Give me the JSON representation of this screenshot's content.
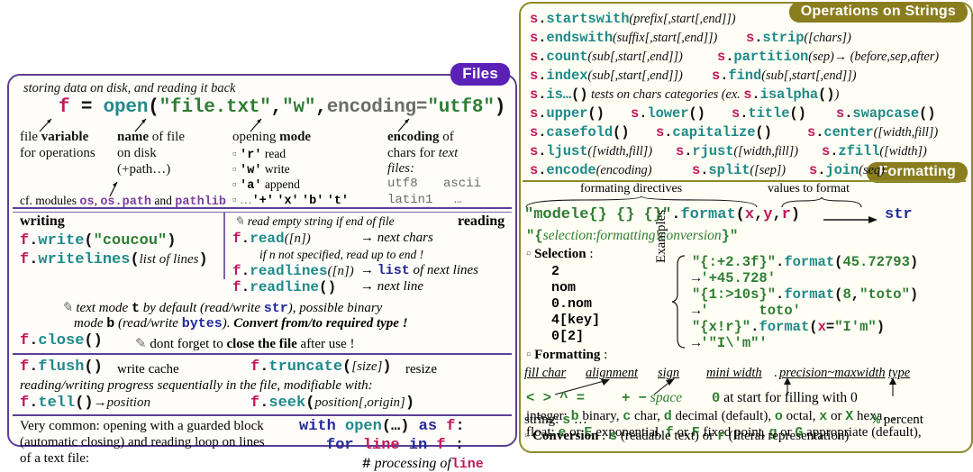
{
  "files_panel": {
    "badge": "Files",
    "intro": "storing data on disk, and reading it back",
    "open_line": {
      "f": "f",
      "eq": "=",
      "open": "open",
      "paren_open": "(",
      "filename": "\"file.txt\"",
      "comma1": ",",
      "mode": "\"w\"",
      "comma2": ",",
      "encoding_kw": "encoding=",
      "encoding_val": "\"utf8\"",
      "paren_close": ")"
    },
    "columns": [
      {
        "title_plain": "file ",
        "title_bold": "variable",
        "lines": [
          "for operations"
        ]
      },
      {
        "title_bold": "name",
        "title_plain": " of file",
        "lines": [
          "on disk",
          "(+path…)"
        ]
      },
      {
        "title_plain": "opening ",
        "title_bold": "mode",
        "modes": [
          {
            "code": "'r'",
            "desc": "read"
          },
          {
            "code": "'w'",
            "desc": "write"
          },
          {
            "code": "'a'",
            "desc": "append"
          }
        ],
        "extra_prefix": "…",
        "extra_codes": [
          "'+'",
          "'x'",
          "'b'",
          "'t'"
        ]
      },
      {
        "title_bold": "encoding",
        "title_plain": " of",
        "lines": [
          "chars for ",
          "files:"
        ],
        "lines_em": "text",
        "encodings": [
          "utf8",
          "ascii",
          "latin1",
          "…"
        ]
      }
    ],
    "cf_modules": {
      "prefix": "cf. modules ",
      "mod1": "os",
      "sep1": ", ",
      "mod2": "os.path",
      "and": " and ",
      "mod3": "pathlib"
    },
    "writing": {
      "title": "writing",
      "lines": [
        {
          "obj": "f",
          "dot": ".",
          "fn": "write",
          "args_open": "(",
          "arg_str": "\"coucou\"",
          "args_close": ")"
        },
        {
          "obj": "f",
          "dot": ".",
          "fn": "writelines",
          "args_open": "(",
          "arg_em": "list of lines",
          "args_close": ")"
        }
      ]
    },
    "reading": {
      "title": "reading",
      "note": "read empty string if end of file",
      "lines": [
        {
          "obj": "f",
          "dot": ".",
          "fn": "read",
          "args": "([n])",
          "result": "→ next chars"
        },
        {
          "obj": "f",
          "dot": ".",
          "fn": "readlines",
          "args": "([n])",
          "result_pre": "→ ",
          "result_code": "list",
          "result_post": " of next lines"
        },
        {
          "obj": "f",
          "dot": ".",
          "fn": "readline",
          "args": "()",
          "result": "→ next line"
        }
      ],
      "subnote": "if n not specified, read up to end !"
    },
    "mode_note_1_a": "text mode ",
    "mode_note_1_b": "t",
    "mode_note_1_c": " by default (read/write ",
    "mode_note_1_d": "str",
    "mode_note_1_e": "), possible binary",
    "mode_note_2_a": "mode  ",
    "mode_note_2_b": "b",
    "mode_note_2_c": " (read/write ",
    "mode_note_2_d": "bytes",
    "mode_note_2_e": "). ",
    "mode_note_2_f": "Convert from/to required type !",
    "close": {
      "obj": "f",
      "dot": ".",
      "fn": "close",
      "args": "()",
      "note_a": "dont forget to ",
      "note_b": "close the file",
      "note_c": " after use !"
    },
    "flush": {
      "obj": "f",
      "dot": ".",
      "fn": "flush",
      "args": "()",
      "desc": "write cache"
    },
    "truncate": {
      "obj": "f",
      "dot": ".",
      "fn": "truncate",
      "args_open": "(",
      "arg_em": "[size]",
      "args_close": ")",
      "desc": "resize"
    },
    "progress_note": "reading/writing progress sequentially in the file, modifiable with:",
    "tell": {
      "obj": "f",
      "dot": ".",
      "fn": "tell",
      "args": "()",
      "arrow": "→",
      "result_em": "position"
    },
    "seek": {
      "obj": "f",
      "dot": ".",
      "fn": "seek",
      "args_open": "(",
      "arg_em": "position[,origin]",
      "args_close": ")"
    },
    "footer_text": [
      "Very common: opening with a guarded block",
      "(automatic closing) and reading loop on lines",
      "of a text file:"
    ],
    "footer_code": {
      "l1_kw1": "with",
      "l1_fn": "open",
      "l1_args": "(…)",
      "l1_kw2": "as",
      "l1_var": "f",
      "l1_colon": ":",
      "l2_kw1": "for",
      "l2_var": "line",
      "l2_kw2": "in",
      "l2_var2": "f",
      "l2_colon": ":",
      "l3_hash": "#",
      "l3_text": "processing of",
      "l3_code": "line"
    }
  },
  "strings_panel": {
    "badge": "Operations on Strings",
    "methods": [
      [
        {
          "obj": "s",
          "fn": "startswith",
          "args": "(prefix[,start[,end]])"
        }
      ],
      [
        {
          "obj": "s",
          "fn": "endswith",
          "args": "(suffix[,start[,end]])"
        },
        {
          "obj": "s",
          "fn": "strip",
          "args": "([chars])"
        }
      ],
      [
        {
          "obj": "s",
          "fn": "count",
          "args": "(sub[,start[,end]])"
        },
        {
          "obj": "s",
          "fn": "partition",
          "args": "(sep)",
          "arrow": "→ (before,sep,after)"
        }
      ],
      [
        {
          "obj": "s",
          "fn": "index",
          "args": "(sub[,start[,end]])"
        },
        {
          "obj": "s",
          "fn": "find",
          "args": "(sub[,start[,end]])"
        }
      ],
      [
        {
          "obj": "s",
          "fn": "is…",
          "args": "()",
          "desc": "tests on chars categories (ex. ",
          "ex_obj": "s",
          "ex_fn": "isalpha",
          "ex_args": "()",
          "desc_end": ")"
        }
      ],
      [
        {
          "obj": "s",
          "fn": "upper",
          "args": "()"
        },
        {
          "obj": "s",
          "fn": "lower",
          "args": "()"
        },
        {
          "obj": "s",
          "fn": "title",
          "args": "()"
        },
        {
          "obj": "s",
          "fn": "swapcase",
          "args": "()"
        }
      ],
      [
        {
          "obj": "s",
          "fn": "casefold",
          "args": "()"
        },
        {
          "obj": "s",
          "fn": "capitalize",
          "args": "()"
        },
        {
          "obj": "s",
          "fn": "center",
          "args": "([width,fill])"
        }
      ],
      [
        {
          "obj": "s",
          "fn": "ljust",
          "args": "([width,fill])"
        },
        {
          "obj": "s",
          "fn": "rjust",
          "args": "([width,fill])"
        },
        {
          "obj": "s",
          "fn": "zfill",
          "args": "([width])"
        }
      ],
      [
        {
          "obj": "s",
          "fn": "encode",
          "args": "(encoding)"
        },
        {
          "obj": "s",
          "fn": "split",
          "args": "([sep])"
        },
        {
          "obj": "s",
          "fn": "join",
          "args": "(seq)"
        }
      ]
    ]
  },
  "formatting_panel": {
    "badge": "Formatting",
    "label_directives": "formating directives",
    "label_values": "values to format",
    "format_line": {
      "template": "\"modele{} {} {}\"",
      "dot": ".",
      "fn": "format",
      "paren_open": "(",
      "args": [
        "x",
        "y",
        "r"
      ],
      "paren_close": ")",
      "result": "str"
    },
    "spec_line": {
      "q1": "\"",
      "brace_open": "{",
      "selection": "selection",
      "colon": ":",
      "formatting": "formatting",
      "bang": "!",
      "conversion": "conversion",
      "brace_close": "}",
      "q2": "\""
    },
    "selection": {
      "title": "Selection",
      "colon": ":",
      "items": [
        "2",
        "nom",
        "0.nom",
        "4[key]",
        "0[2]"
      ]
    },
    "examples": {
      "label": "Examples",
      "rows": [
        {
          "code": "\"{:+2.3f}\"",
          "dot": ".",
          "fn": "format",
          "paren_open": "(",
          "arg": "45.72793",
          "paren_close": ")"
        },
        {
          "arrow": "→",
          "result": "'+45.728'"
        },
        {
          "code": "\"{1:>10s}\"",
          "dot": ".",
          "fn": "format",
          "paren_open": "(",
          "arg": "8",
          "comma": ",",
          "arg2": "\"toto\"",
          "paren_close": ")"
        },
        {
          "arrow": "→",
          "result": "'      toto'"
        },
        {
          "code": "\"{x!r}\"",
          "dot": ".",
          "fn": "format",
          "paren_open": "(",
          "argvar": "x",
          "eq": "=",
          "arg2": "\"I'm\"",
          "paren_close": ")"
        },
        {
          "arrow": "→",
          "result": "'\"I\\'m\"'"
        }
      ]
    },
    "formatting_section": {
      "title": "Formatting",
      "colon": ":",
      "headers": [
        "fill char",
        "alignment",
        "sign",
        "mini width",
        ".",
        "precision~maxwidth",
        "type"
      ],
      "align_chars": "< > ^ =",
      "sign_chars": "+ −",
      "sign_space": "space",
      "zero": "0",
      "zero_desc": " at start for filling with 0",
      "types": [
        {
          "label": "integer: ",
          "parts": [
            {
              "c": "b",
              "t": " binary, "
            },
            {
              "c": "c",
              "t": " char, "
            },
            {
              "c": "d",
              "t": " decimal (default), "
            },
            {
              "c": "o",
              "t": " octal, "
            },
            {
              "c": "x",
              "t": " or "
            },
            {
              "c": "X",
              "t": " hexa…"
            }
          ]
        },
        {
          "label": "float: ",
          "parts": [
            {
              "c": "e",
              "t": " or "
            },
            {
              "c": "E",
              "t": " exponential, "
            },
            {
              "c": "f",
              "t": " or "
            },
            {
              "c": "F",
              "t": " fixed point, "
            },
            {
              "c": "g",
              "t": " or "
            },
            {
              "c": "G",
              "t": " appropriate (default),"
            }
          ]
        },
        {
          "label": "string: ",
          "parts": [
            {
              "c": "s",
              "t": " …"
            }
          ]
        }
      ],
      "percent_code": "%",
      "percent_text": " percent"
    },
    "conversion": {
      "title": "Conversion",
      "colon": " : ",
      "s": "s",
      "s_desc": " (readable text) or ",
      "r": "r",
      "r_desc": " (literal representation)"
    }
  }
}
